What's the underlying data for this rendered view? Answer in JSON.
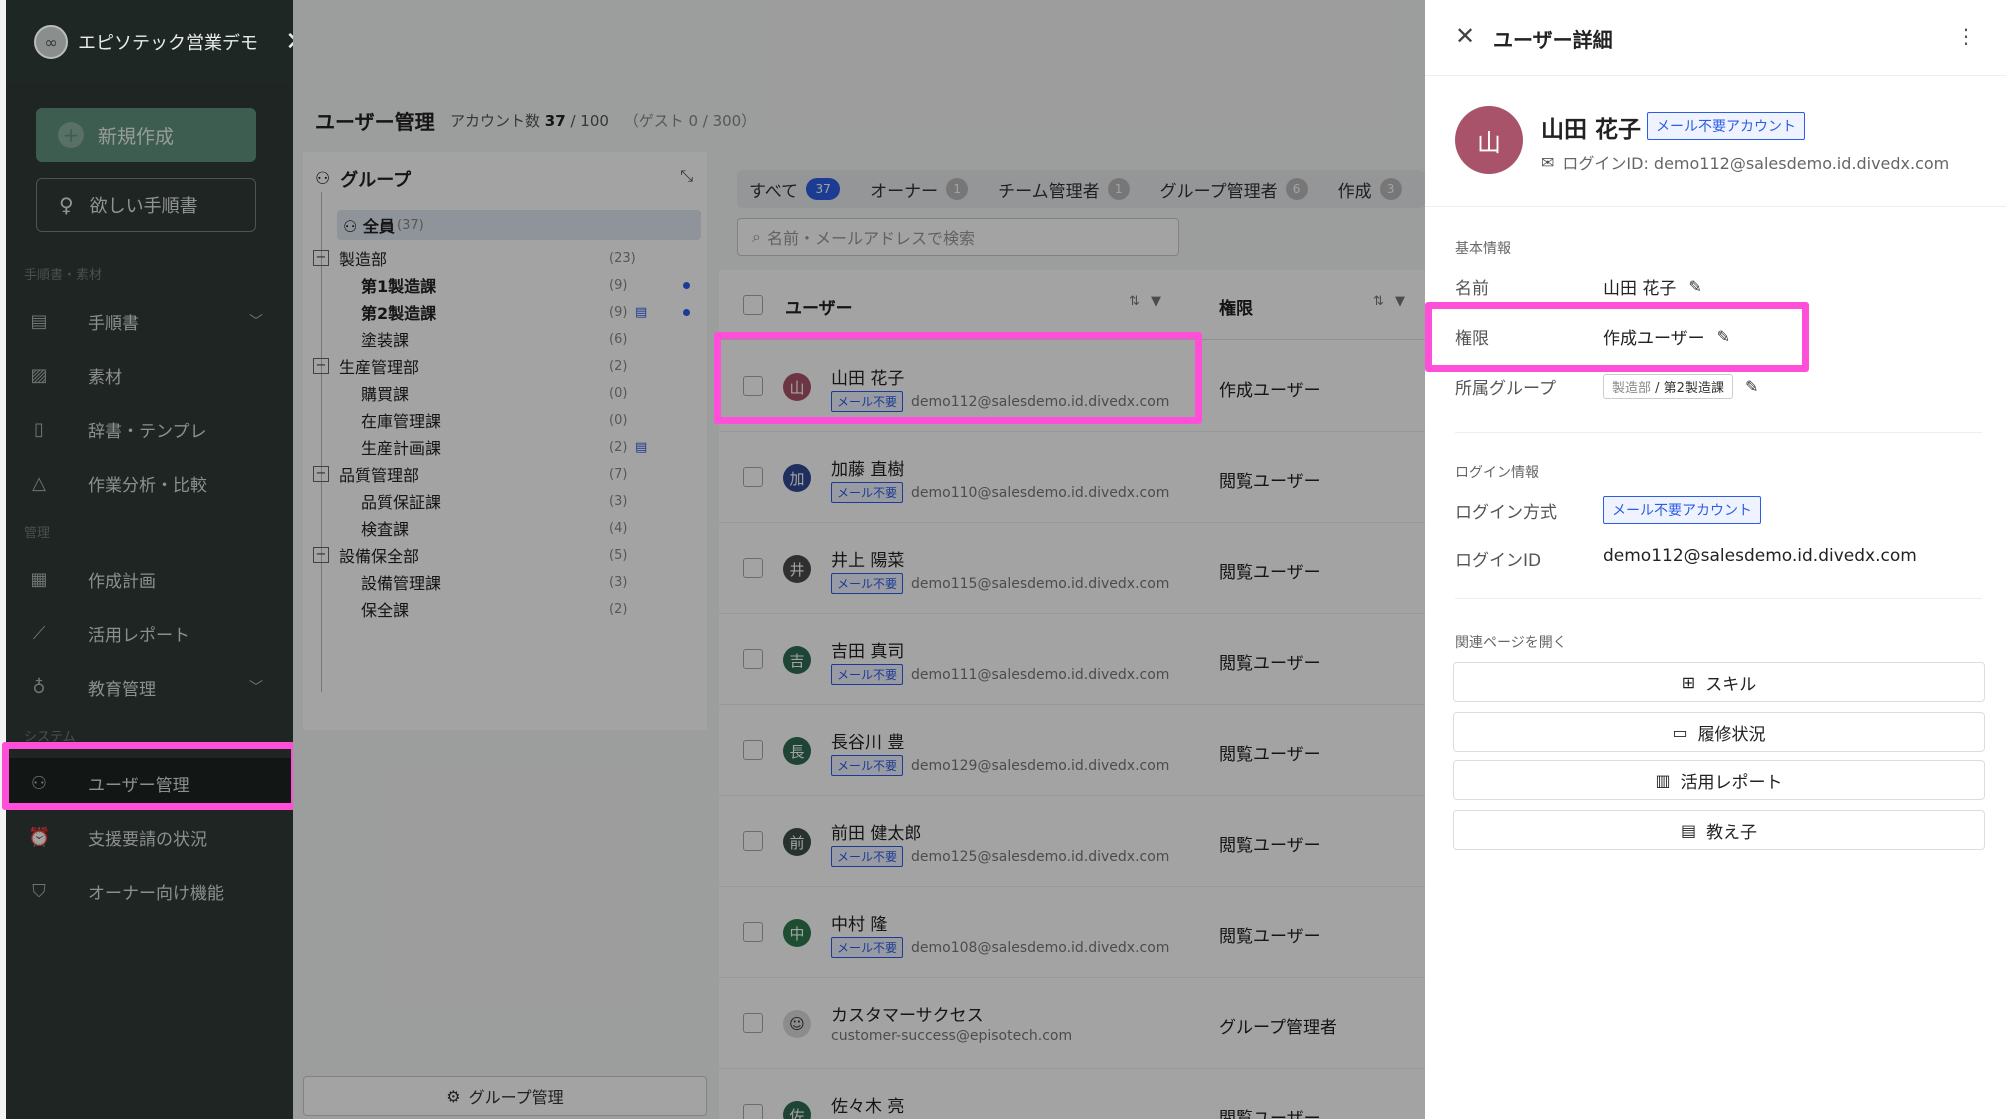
{
  "workspace": {
    "name": "エピソテック営業デモ",
    "close": "✕"
  },
  "sidebar": {
    "new_button": "新規作成",
    "want_button": "欲しい手順書",
    "section_materials": "手順書・素材",
    "section_manage": "管理",
    "section_system": "システム",
    "items": [
      {
        "label": "手順書"
      },
      {
        "label": "素材"
      },
      {
        "label": "辞書・テンプレ"
      },
      {
        "label": "作業分析・比較"
      },
      {
        "label": "作成計画"
      },
      {
        "label": "活用レポート"
      },
      {
        "label": "教育管理"
      },
      {
        "label": "ユーザー管理"
      },
      {
        "label": "支援要請の状況"
      },
      {
        "label": "オーナー向け機能"
      }
    ]
  },
  "main": {
    "title": "ユーザー管理",
    "account_label": "アカウント数",
    "account_count": "37",
    "account_total": "/ 100",
    "guest": "（ゲスト 0 / 300）",
    "groups": {
      "title": "グループ",
      "all_label": "全員",
      "all_count": "(37)",
      "rows": [
        {
          "label": "製造部",
          "count": "(23)"
        },
        {
          "label": "第1製造課",
          "count": "(9)"
        },
        {
          "label": "第2製造課",
          "count": "(9)"
        },
        {
          "label": "塗装課",
          "count": "(6)"
        },
        {
          "label": "生産管理部",
          "count": "(2)"
        },
        {
          "label": "購買課",
          "count": "(0)"
        },
        {
          "label": "在庫管理課",
          "count": "(0)"
        },
        {
          "label": "生産計画課",
          "count": "(2)"
        },
        {
          "label": "品質管理部",
          "count": "(7)"
        },
        {
          "label": "品質保証課",
          "count": "(3)"
        },
        {
          "label": "検査課",
          "count": "(4)"
        },
        {
          "label": "設備保全部",
          "count": "(5)"
        },
        {
          "label": "設備管理課",
          "count": "(3)"
        },
        {
          "label": "保全課",
          "count": "(2)"
        }
      ],
      "manage_button": "グループ管理"
    },
    "tabs": [
      {
        "label": "すべて",
        "count": "37"
      },
      {
        "label": "オーナー",
        "count": "1"
      },
      {
        "label": "チーム管理者",
        "count": "1"
      },
      {
        "label": "グループ管理者",
        "count": "6"
      },
      {
        "label": "作成",
        "count": "3"
      }
    ],
    "search_placeholder": "名前・メールアドレスで検索",
    "table": {
      "col_user": "ユーザー",
      "col_role": "権限",
      "rows": [
        {
          "initial": "山",
          "name": "山田 花子",
          "tag": "メール不要",
          "email": "demo112@salesdemo.id.divedx.com",
          "role": "作成ユーザー",
          "color": "#a8536a"
        },
        {
          "initial": "加",
          "name": "加藤 直樹",
          "tag": "メール不要",
          "email": "demo110@salesdemo.id.divedx.com",
          "role": "閲覧ユーザー",
          "color": "#2f4a93"
        },
        {
          "initial": "井",
          "name": "井上 陽菜",
          "tag": "メール不要",
          "email": "demo115@salesdemo.id.divedx.com",
          "role": "閲覧ユーザー",
          "color": "#4a4a4a"
        },
        {
          "initial": "吉",
          "name": "吉田 真司",
          "tag": "メール不要",
          "email": "demo111@salesdemo.id.divedx.com",
          "role": "閲覧ユーザー",
          "color": "#2f6b55"
        },
        {
          "initial": "長",
          "name": "長谷川 豊",
          "tag": "メール不要",
          "email": "demo129@salesdemo.id.divedx.com",
          "role": "閲覧ユーザー",
          "color": "#2f6b55"
        },
        {
          "initial": "前",
          "name": "前田 健太郎",
          "tag": "メール不要",
          "email": "demo125@salesdemo.id.divedx.com",
          "role": "閲覧ユーザー",
          "color": "#3e4e48"
        },
        {
          "initial": "中",
          "name": "中村 隆",
          "tag": "メール不要",
          "email": "demo108@salesdemo.id.divedx.com",
          "role": "閲覧ユーザー",
          "color": "#2f7a4d"
        },
        {
          "initial": "",
          "name": "カスタマーサクセス",
          "tag": "",
          "email": "customer-success@episotech.com",
          "role": "グループ管理者",
          "color": "#555555"
        },
        {
          "initial": "佐",
          "name": "佐々木 亮",
          "tag": "",
          "email": "",
          "role": "閲覧ユーザー",
          "color": "#2f6b55"
        }
      ]
    }
  },
  "panel": {
    "title": "ユーザー詳細",
    "avatar_initial": "山",
    "name": "山田 花子",
    "name_tag": "メール不要アカウント",
    "login_id_line": "ログインID: demo112@salesdemo.id.divedx.com",
    "basic_section": "基本情報",
    "name_label": "名前",
    "name_value": "山田 花子",
    "role_label": "権限",
    "role_value": "作成ユーザー",
    "group_label": "所属グループ",
    "group_parent": "製造部",
    "group_child": "第2製造課",
    "login_section": "ログイン情報",
    "login_method_label": "ログイン方式",
    "login_method_value": "メール不要アカウント",
    "login_id_label": "ログインID",
    "login_id_value": "demo112@salesdemo.id.divedx.com",
    "related_section": "関連ページを開く",
    "links": [
      {
        "label": "スキル"
      },
      {
        "label": "履修状況"
      },
      {
        "label": "活用レポート"
      },
      {
        "label": "教え子"
      }
    ]
  },
  "colors": {
    "accent": "#2c5de5",
    "highlight": "#ff4fd8",
    "sidebar": "#2f3a36"
  }
}
